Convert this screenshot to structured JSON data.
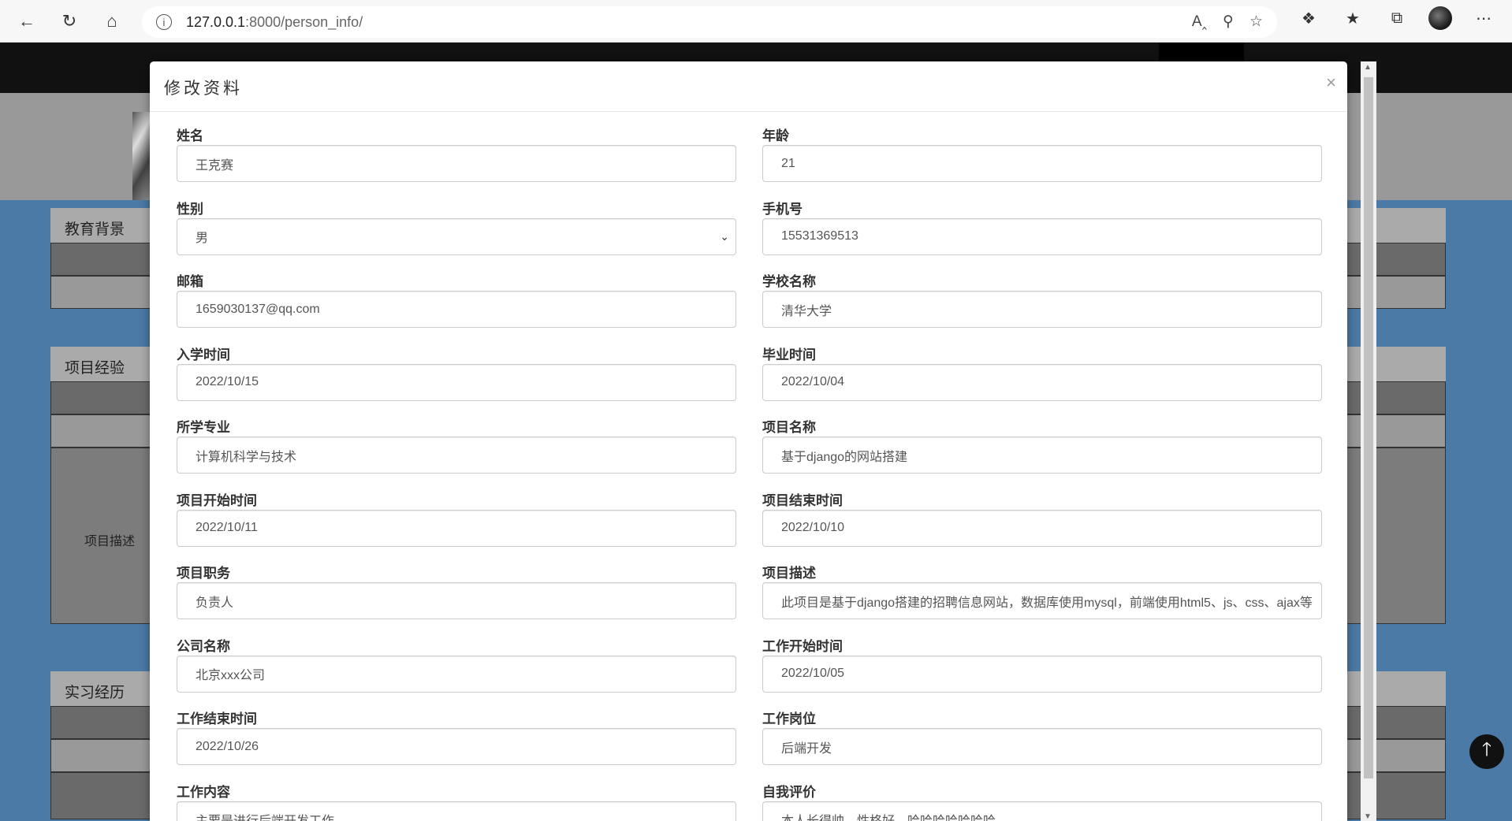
{
  "browser": {
    "url_host": "127.0.0.1",
    "url_rest": ":8000/person_info/"
  },
  "background": {
    "panels": [
      {
        "title": "教育背景"
      },
      {
        "title": "项目经验",
        "desc_label": "项目描述"
      },
      {
        "title": "实习经历"
      }
    ]
  },
  "modal": {
    "title": "修改资料",
    "close": "×",
    "fields": [
      {
        "label": "姓名",
        "value": "王克赛"
      },
      {
        "label": "年龄",
        "value": "21"
      },
      {
        "label": "性别",
        "value": "男"
      },
      {
        "label": "手机号",
        "value": "15531369513"
      },
      {
        "label": "邮箱",
        "value": "1659030137@qq.com"
      },
      {
        "label": "学校名称",
        "value": "清华大学"
      },
      {
        "label": "入学时间",
        "value": "2022/10/15"
      },
      {
        "label": "毕业时间",
        "value": "2022/10/04"
      },
      {
        "label": "所学专业",
        "value": "计算机科学与技术"
      },
      {
        "label": "项目名称",
        "value": "基于django的网站搭建"
      },
      {
        "label": "项目开始时间",
        "value": "2022/10/11"
      },
      {
        "label": "项目结束时间",
        "value": "2022/10/10"
      },
      {
        "label": "项目职务",
        "value": "负责人"
      },
      {
        "label": "项目描述",
        "value": "此项目是基于django搭建的招聘信息网站，数据库使用mysql，前端使用html5、js、css、ajax等"
      },
      {
        "label": "公司名称",
        "value": "北京xxx公司"
      },
      {
        "label": "工作开始时间",
        "value": "2022/10/05"
      },
      {
        "label": "工作结束时间",
        "value": "2022/10/26"
      },
      {
        "label": "工作岗位",
        "value": "后端开发"
      },
      {
        "label": "工作内容",
        "value": "主要是进行后端开发工作"
      },
      {
        "label": "自我评价",
        "value": "本人长得帅，性格好，哈哈哈哈哈哈哈"
      }
    ]
  }
}
